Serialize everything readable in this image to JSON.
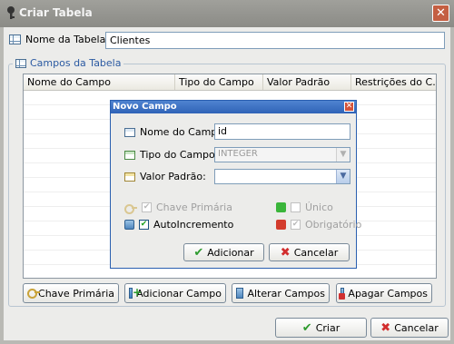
{
  "window": {
    "title": "Criar Tabela"
  },
  "nome_tabela": {
    "label": "Nome da Tabela:",
    "value": "Clientes"
  },
  "campos": {
    "legend": "Campos da Tabela",
    "columns": [
      "Nome do Campo",
      "Tipo do Campo",
      "Valor Padrão",
      "Restrições do C..."
    ]
  },
  "dialog": {
    "title": "Novo Campo",
    "nome_label": "Nome do Campo:",
    "nome_value": "id",
    "tipo_label": "Tipo do Campo:",
    "tipo_value": "INTEGER",
    "valor_label": "Valor Padrão:",
    "valor_value": "",
    "chave_primaria": {
      "label": "Chave Primária",
      "checked": true,
      "enabled": false
    },
    "unico": {
      "label": "Único",
      "checked": false,
      "enabled": false
    },
    "autoincremento": {
      "label": "AutoIncremento",
      "checked": true,
      "enabled": true
    },
    "obrigatorio": {
      "label": "Obrigatório",
      "checked": true,
      "enabled": false
    },
    "add_label": "Adicionar",
    "cancel_label": "Cancelar"
  },
  "buttons": {
    "chave_primaria": "Chave Primária",
    "adicionar_campo": "Adicionar Campo",
    "alterar_campos": "Alterar Campos",
    "apagar_campos": "Apagar Campos",
    "criar": "Criar",
    "cancelar": "Cancelar"
  }
}
